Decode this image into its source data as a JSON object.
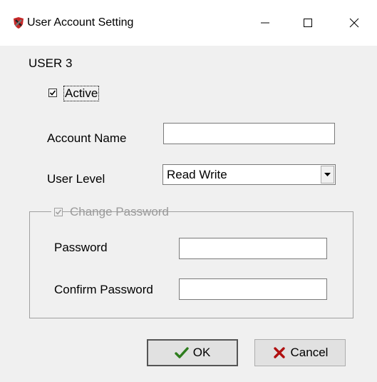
{
  "window": {
    "title": "User Account Setting",
    "controls": {
      "minimize": "—",
      "maximize": "☐",
      "close": "✕"
    }
  },
  "user": {
    "heading": "USER 3"
  },
  "active": {
    "label": "Active",
    "checked": true
  },
  "account_name": {
    "label": "Account Name",
    "value": ""
  },
  "user_level": {
    "label": "User Level",
    "selected": "Read Write"
  },
  "change_password": {
    "label": "Change Password",
    "checked": true,
    "disabled": true,
    "password": {
      "label": "Password",
      "value": ""
    },
    "confirm_password": {
      "label": "Confirm Password",
      "value": ""
    }
  },
  "buttons": {
    "ok": "OK",
    "cancel": "Cancel"
  },
  "icons": {
    "app": "shield-sword-icon",
    "ok": "checkmark-icon",
    "cancel": "x-mark-icon",
    "ok_color": "#2e7d1e",
    "cancel_color": "#b01010"
  }
}
